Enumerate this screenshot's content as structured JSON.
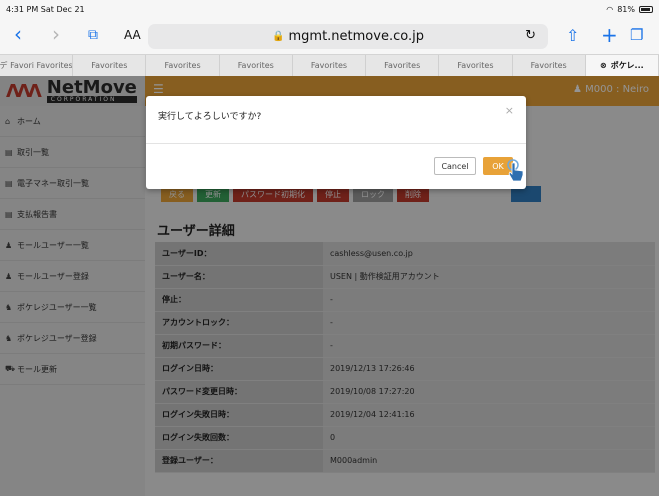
{
  "status_bar": {
    "time": "4:31 PM  Sat Dec 21",
    "battery": "81%"
  },
  "browser": {
    "text_size_label": "AA",
    "url": "mgmt.netmove.co.jp",
    "tabs": [
      "デ Favori Favorites",
      "Favorites",
      "Favorites",
      "Favorites",
      "Favorites",
      "Favorites",
      "Favorites",
      "Favorites",
      "ポケレ..."
    ]
  },
  "header": {
    "logo_name": "NetMove",
    "logo_sub": "CORPORATION",
    "user": "M000 : Neiro"
  },
  "sidebar": {
    "items": [
      {
        "icon": "home-icon",
        "glyph": "⌂",
        "label": "ホーム"
      },
      {
        "icon": "document-icon",
        "glyph": "▤",
        "label": "取引一覧"
      },
      {
        "icon": "document-icon",
        "glyph": "▤",
        "label": "電子マネー取引一覧"
      },
      {
        "icon": "document-icon",
        "glyph": "▤",
        "label": "支払報告書"
      },
      {
        "icon": "user-icon",
        "glyph": "♟",
        "label": "モールユーザー一覧"
      },
      {
        "icon": "user-icon",
        "glyph": "♟",
        "label": "モールユーザー登録"
      },
      {
        "icon": "users-icon",
        "glyph": "♞",
        "label": "ポケレジユーザー一覧"
      },
      {
        "icon": "users-icon",
        "glyph": "♞",
        "label": "ポケレジユーザー登録"
      },
      {
        "icon": "cart-icon",
        "glyph": "⛟",
        "label": "モール更新"
      }
    ]
  },
  "main": {
    "action_buttons": [
      {
        "label": "戻る",
        "color": "#e8a238"
      },
      {
        "label": "更新",
        "color": "#3ba55c"
      },
      {
        "label": "パスワード初期化",
        "color": "#c0392b"
      },
      {
        "label": "停止",
        "color": "#c0392b"
      },
      {
        "label": "ロック",
        "color": "#9e9e9e"
      },
      {
        "label": "削除",
        "color": "#c0392b"
      }
    ],
    "section_title": "ユーザー詳細",
    "rows": [
      {
        "key": "ユーザーID：",
        "value": "cashless@usen.co.jp"
      },
      {
        "key": "ユーザー名：",
        "value": "USEN | 動作検証用アカウント"
      },
      {
        "key": "停止：",
        "value": "-"
      },
      {
        "key": "アカウントロック：",
        "value": "-"
      },
      {
        "key": "初期パスワード：",
        "value": "-"
      },
      {
        "key": "ログイン日時：",
        "value": "2019/12/13 17:26:46"
      },
      {
        "key": "パスワード変更日時：",
        "value": "2019/10/08 17:27:20"
      },
      {
        "key": "ログイン失敗日時：",
        "value": "2019/12/04 12:41:16"
      },
      {
        "key": "ログイン失敗回数：",
        "value": "0"
      },
      {
        "key": "登録ユーザー：",
        "value": "M000admin"
      }
    ]
  },
  "dialog": {
    "message": "実行してよろしいですか?",
    "cancel": "Cancel",
    "ok": "OK"
  }
}
